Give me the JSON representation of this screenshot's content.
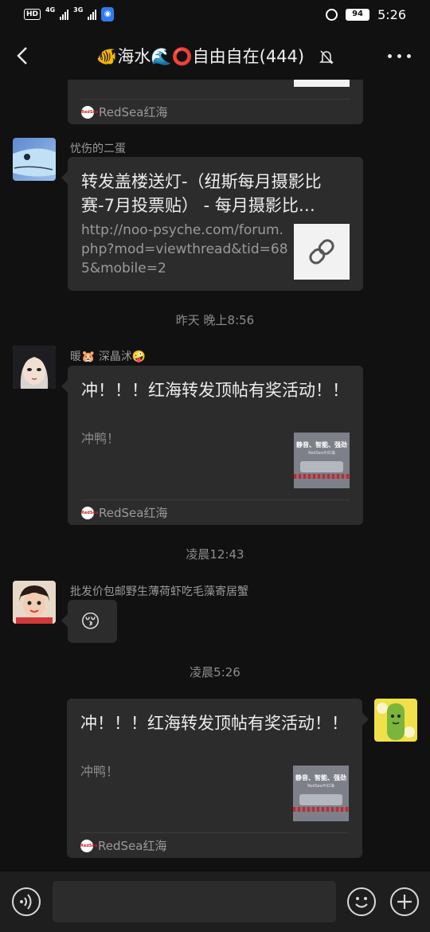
{
  "status_bar": {
    "hd": "HD",
    "sim1": "4G",
    "sim2": "3G",
    "shield_icon": "shield-icon",
    "battery": "94",
    "clock": "5:26"
  },
  "nav": {
    "title": "🐠海水🌊⭕自由自在(444)"
  },
  "messages": {
    "top_card_source": "RedSea红海",
    "m1": {
      "sender": "忧伤的二蛋",
      "title": "转发盖楼送灯-（纽斯每月摄影比赛-7月投票贴） - 每月摄影比…",
      "url": "http://noo-psyche.com/forum.php?mod=viewthread&tid=685&mobile=2"
    },
    "time1": "昨天 晚上8:56",
    "m2": {
      "sender": "暖🐹 深晶沭🤪",
      "title": "冲！！！红海转发顶帖有奖活动！！",
      "desc": "冲鸭！",
      "thumb_line1": "静音、智能、强劲",
      "thumb_line2": "RedSea®红海",
      "source": "RedSea红海"
    },
    "time2": "凌晨12:43",
    "m3": {
      "sender": "批发价包邮野生薄荷虾吃毛藻寄居蟹",
      "emoji": "😚"
    },
    "time3": "凌晨5:26",
    "m4": {
      "title": "冲！！！红海转发顶帖有奖活动！！",
      "desc": "冲鸭！",
      "thumb_line1": "静音、智能、强劲",
      "thumb_line2": "RedSea®红海",
      "source": "RedSea红海"
    }
  },
  "logo_text": "RedSea",
  "colors": {
    "background": "#111111",
    "bubble": "#2c2c2c",
    "input_bar": "#1e1e1e"
  }
}
